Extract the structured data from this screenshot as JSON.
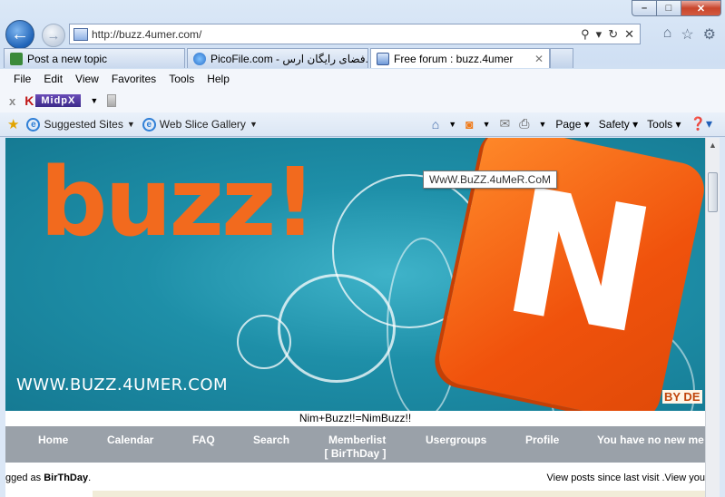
{
  "window": {
    "controls": {
      "minimize": "–",
      "maximize": "□",
      "close": "✕"
    }
  },
  "addressbar": {
    "url": "http://buzz.4umer.com/",
    "search_icon": "search-icon",
    "refresh_icon": "refresh-icon",
    "stop_icon": "stop-icon"
  },
  "tabs": [
    {
      "label": "Post a new topic",
      "icon_color": "#3a8a3a"
    },
    {
      "label": "PicoFile.com - فضای رایگان ارس...",
      "icon_color": "#3a7fd0"
    },
    {
      "label": "Free forum : buzz.4umer",
      "icon_color": "#3a6fc0",
      "active": true
    }
  ],
  "menu": [
    "File",
    "Edit",
    "View",
    "Favorites",
    "Tools",
    "Help"
  ],
  "toolbar2": {
    "close_label": "x",
    "midpx_logo": "MidpX"
  },
  "favorites": {
    "suggested": "Suggested Sites",
    "webslice": "Web Slice Gallery"
  },
  "command_bar": {
    "page": "Page",
    "safety": "Safety",
    "tools": "Tools"
  },
  "banner": {
    "buzz_text": "buzz!",
    "n_letter": "N",
    "site_url": "WWW.BUZZ.4UMER.COM",
    "by_text": "BY DE",
    "tooltip": "WwW.BuZZ.4uMeR.CoM"
  },
  "forum": {
    "caption": "Nim+Buzz!!=NimBuzz!!",
    "nav": [
      "Home",
      "Calendar",
      "FAQ",
      "Search",
      "Memberlist",
      "Usergroups",
      "Profile",
      "You have no new me"
    ],
    "birthday": "[ BirThDay ]",
    "logged_prefix": "gged as ",
    "logged_user": "BirThDay",
    "logged_suffix": ".",
    "view_links": "View posts since last visit .View you"
  }
}
